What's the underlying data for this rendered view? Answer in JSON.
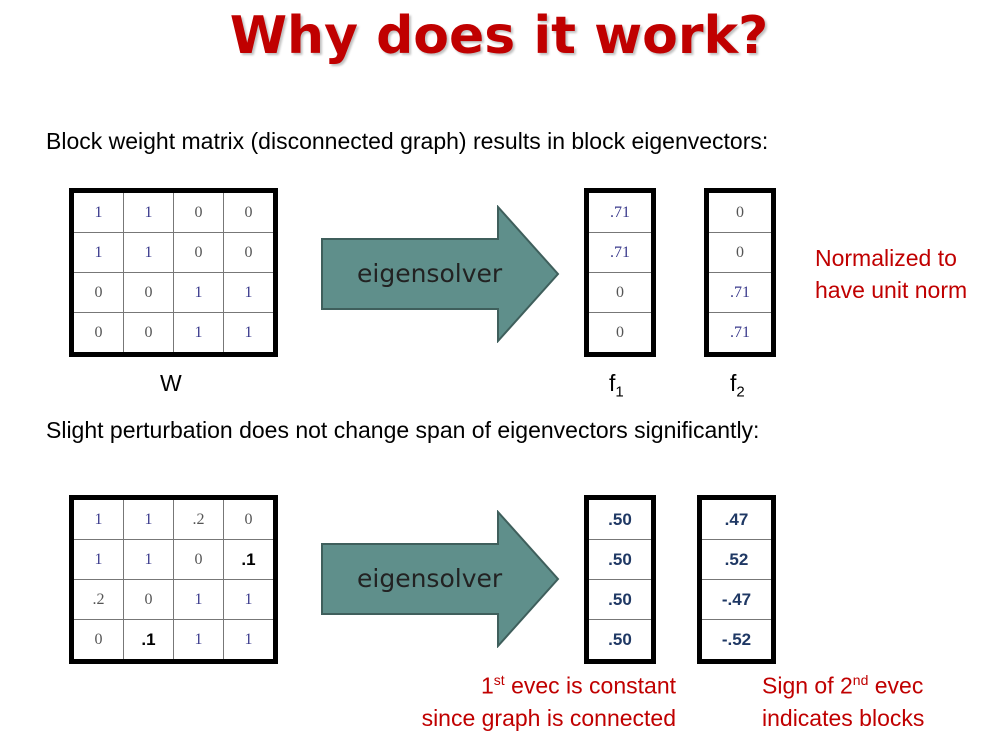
{
  "title": "Why does it work?",
  "section1": {
    "caption": "Block weight matrix (disconnected graph) results in block eigenvectors:",
    "matrix": [
      [
        "1",
        "1",
        "0",
        "0"
      ],
      [
        "1",
        "1",
        "0",
        "0"
      ],
      [
        "0",
        "0",
        "1",
        "1"
      ],
      [
        "0",
        "0",
        "1",
        "1"
      ]
    ],
    "matrix_label": "W",
    "arrow_label": "eigensolver",
    "f1": [
      ".71",
      ".71",
      "0",
      "0"
    ],
    "f2": [
      "0",
      "0",
      ".71",
      ".71"
    ],
    "f1_label": "f",
    "f1_sub": "1",
    "f2_label": "f",
    "f2_sub": "2",
    "note_line1": "Normalized to",
    "note_line2": "have unit norm"
  },
  "section2": {
    "caption": "Slight perturbation does not change span of eigenvectors significantly:",
    "matrix": [
      [
        "1",
        "1",
        ".2",
        "0"
      ],
      [
        "1",
        "1",
        "0",
        ".1"
      ],
      [
        ".2",
        "0",
        "1",
        "1"
      ],
      [
        "0",
        ".1",
        "1",
        "1"
      ]
    ],
    "arrow_label": "eigensolver",
    "f1": [
      ".50",
      ".50",
      ".50",
      ".50"
    ],
    "f2": [
      ".47",
      ".52",
      "-.47",
      "-.52"
    ],
    "note1_line1_pre": "1",
    "note1_line1_sup": "st",
    "note1_line1_post": " evec is constant",
    "note1_line2": "since graph is connected",
    "note2_line1_pre": "Sign of 2",
    "note2_line1_sup": "nd",
    "note2_line1_post": " evec",
    "note2_line2": "indicates blocks"
  },
  "colors": {
    "title": "#c00000",
    "note": "#c00000",
    "arrow_fill": "#5f8f8b",
    "arrow_stroke": "#3f5f5c"
  }
}
